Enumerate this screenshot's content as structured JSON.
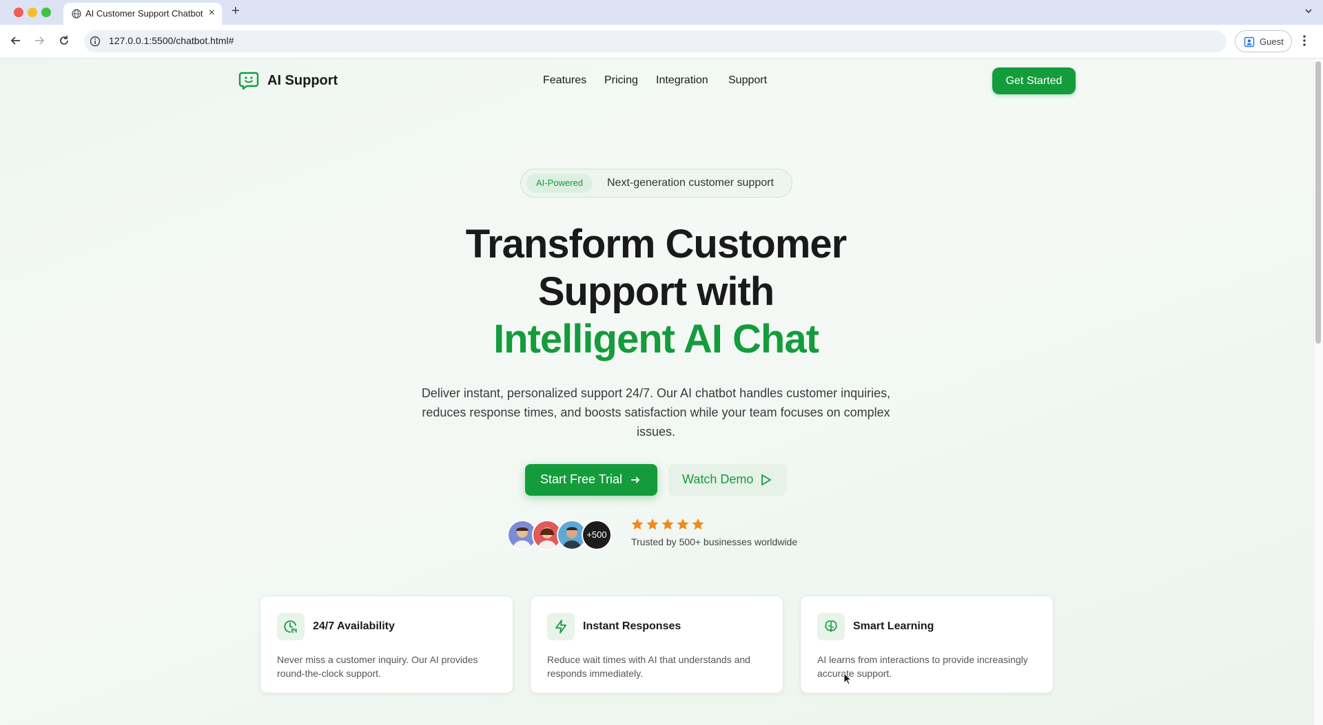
{
  "browser": {
    "tab_title": "AI Customer Support Chatbot",
    "url": "127.0.0.1:5500/chatbot.html#",
    "profile_label": "Guest"
  },
  "nav": {
    "brand": "AI Support",
    "links": [
      "Features",
      "Pricing",
      "Integration",
      "Support"
    ],
    "cta": "Get Started"
  },
  "hero": {
    "badge": "AI-Powered",
    "badge_text": "Next-generation customer support",
    "title_line1": "Transform Customer",
    "title_line2": "Support with",
    "title_highlight": "Intelligent AI Chat",
    "description": "Deliver instant, personalized support 24/7. Our AI chatbot handles customer inquiries, reduces response times, and boosts satisfaction while your team focuses on complex issues.",
    "primary_button": "Start Free Trial",
    "secondary_button": "Watch Demo",
    "avatar_more": "+500",
    "rating_stars": 5,
    "trusted_text": "Trusted by 500+ businesses worldwide"
  },
  "features": [
    {
      "icon": "clock-24-icon",
      "title": "24/7 Availability",
      "text": "Never miss a customer inquiry. Our AI provides round-the-clock support."
    },
    {
      "icon": "lightning-icon",
      "title": "Instant Responses",
      "text": "Reduce wait times with AI that understands and responds immediately."
    },
    {
      "icon": "brain-icon",
      "title": "Smart Learning",
      "text": "AI learns from interactions to provide increasingly accurate support."
    }
  ],
  "colors": {
    "accent": "#149c3c",
    "star": "#f08a1c",
    "background": "#eff6f0"
  }
}
